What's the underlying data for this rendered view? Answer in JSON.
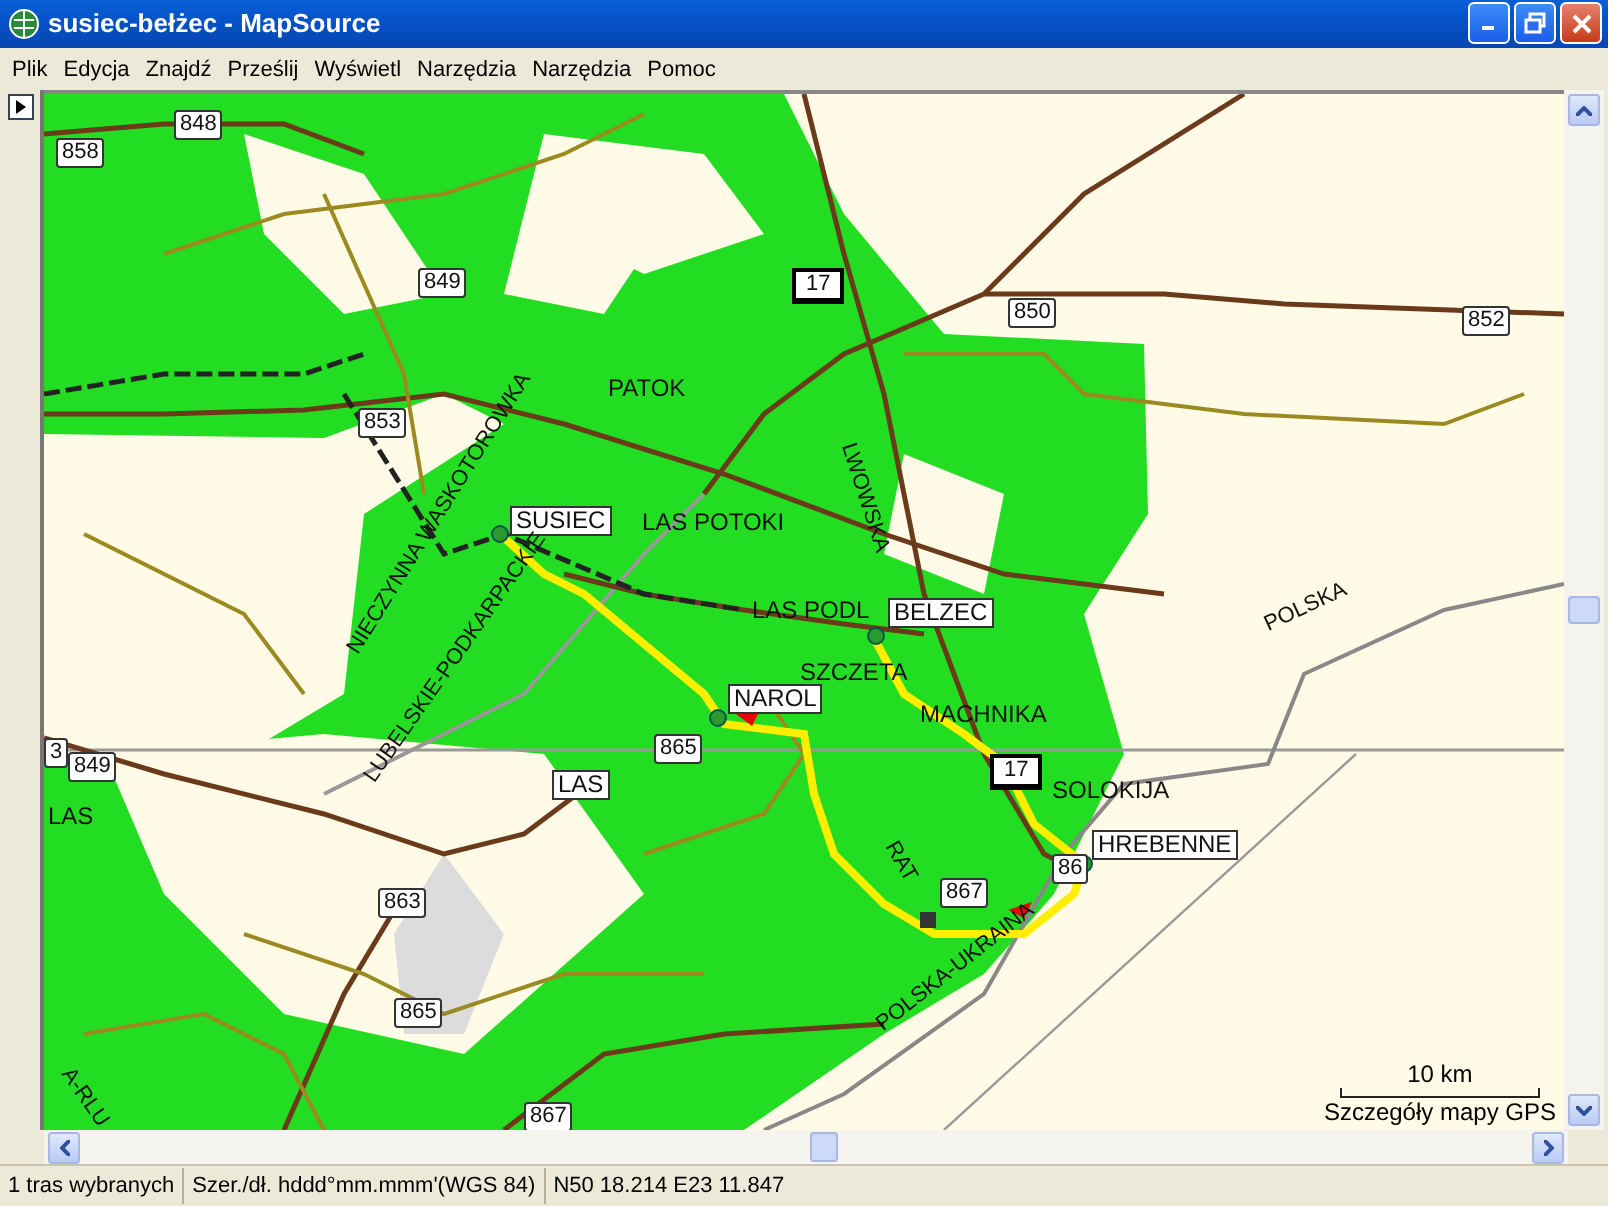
{
  "window": {
    "title": "susiec-bełżec - MapSource"
  },
  "menu": [
    "Plik",
    "Edycja",
    "Znajdź",
    "Prześlij",
    "Wyświetl",
    "Narzędzia",
    "Narzędzia",
    "Pomoc"
  ],
  "map": {
    "labels": [
      {
        "text": "848",
        "kind": "road_number"
      },
      {
        "text": "858",
        "kind": "road_number"
      },
      {
        "text": "849",
        "kind": "road_number"
      },
      {
        "text": "17",
        "kind": "national_road"
      },
      {
        "text": "850",
        "kind": "road_number"
      },
      {
        "text": "852",
        "kind": "road_number"
      },
      {
        "text": "853",
        "kind": "road_number"
      },
      {
        "text": "PATOK",
        "kind": "place"
      },
      {
        "text": "NIECZYNNA WASKOTOROWKA",
        "kind": "rotated"
      },
      {
        "text": "SUSIEC",
        "kind": "place_boxed"
      },
      {
        "text": "LAS POTOKI",
        "kind": "place"
      },
      {
        "text": "LUBELSKIE-PODKARPACKIE",
        "kind": "rotated"
      },
      {
        "text": "LWOWSKA",
        "kind": "rotated"
      },
      {
        "text": "LAS PODL",
        "kind": "place"
      },
      {
        "text": "BELZEC",
        "kind": "place_boxed"
      },
      {
        "text": "SZCZETA",
        "kind": "place"
      },
      {
        "text": "NAROL",
        "kind": "place_boxed"
      },
      {
        "text": "MACHNIKA",
        "kind": "place"
      },
      {
        "text": "POLSKA",
        "kind": "rotated"
      },
      {
        "text": "3",
        "kind": "road_number"
      },
      {
        "text": "849",
        "kind": "road_number"
      },
      {
        "text": "865",
        "kind": "road_number"
      },
      {
        "text": "17",
        "kind": "national_road"
      },
      {
        "text": "SOLOKIJA",
        "kind": "place"
      },
      {
        "text": "LAS",
        "kind": "place_boxed"
      },
      {
        "text": "LAS",
        "kind": "place"
      },
      {
        "text": "HREBENNE",
        "kind": "place_boxed"
      },
      {
        "text": "86",
        "kind": "road_number"
      },
      {
        "text": "RAT",
        "kind": "rotated"
      },
      {
        "text": "867",
        "kind": "road_number"
      },
      {
        "text": "863",
        "kind": "road_number"
      },
      {
        "text": "POLSKA-UKRAINA",
        "kind": "rotated"
      },
      {
        "text": "865",
        "kind": "road_number"
      },
      {
        "text": "A-RLU",
        "kind": "rotated"
      },
      {
        "text": "867",
        "kind": "road_number"
      }
    ],
    "scale": "10 km",
    "map_source": "Szczegóły mapy GPS"
  },
  "status_bar": [
    "1 tras wybranych",
    "Szer./dł. hddd°mm.mmm'(WGS 84)",
    "N50 18.214 E23 11.847"
  ]
}
